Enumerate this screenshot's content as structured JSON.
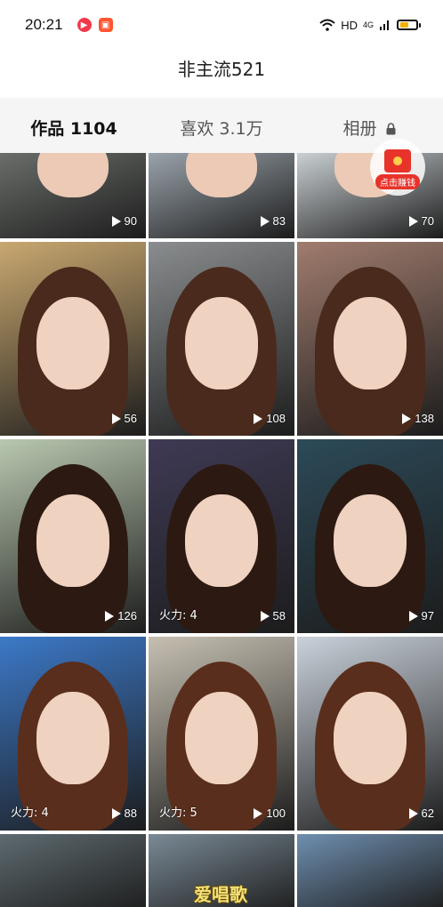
{
  "status_bar": {
    "time": "20:21",
    "network": "HD",
    "signal": "4G",
    "icons": [
      "wifi-icon",
      "signal-icon",
      "battery-icon"
    ]
  },
  "profile": {
    "title": "非主流521"
  },
  "tabs": [
    {
      "label": "作品 1104",
      "active": true
    },
    {
      "label": "喜欢 3.1万",
      "active": false
    },
    {
      "label": "相册",
      "active": false,
      "locked": true
    }
  ],
  "red_envelope": {
    "label": "点击赚钱"
  },
  "videos": [
    {
      "plays": "90",
      "fire": ""
    },
    {
      "plays": "83",
      "fire": ""
    },
    {
      "plays": "70",
      "fire": ""
    },
    {
      "plays": "56",
      "fire": ""
    },
    {
      "plays": "108",
      "fire": ""
    },
    {
      "plays": "138",
      "fire": ""
    },
    {
      "plays": "126",
      "fire": ""
    },
    {
      "plays": "58",
      "fire": "火力: 4"
    },
    {
      "plays": "97",
      "fire": ""
    },
    {
      "plays": "88",
      "fire": "火力: 4"
    },
    {
      "plays": "100",
      "fire": "火力: 5"
    },
    {
      "plays": "62",
      "fire": ""
    }
  ],
  "watermark": "爱唱歌",
  "colors": {
    "tab_bg": "#f5f5f5",
    "accent_red": "#e8332a"
  }
}
